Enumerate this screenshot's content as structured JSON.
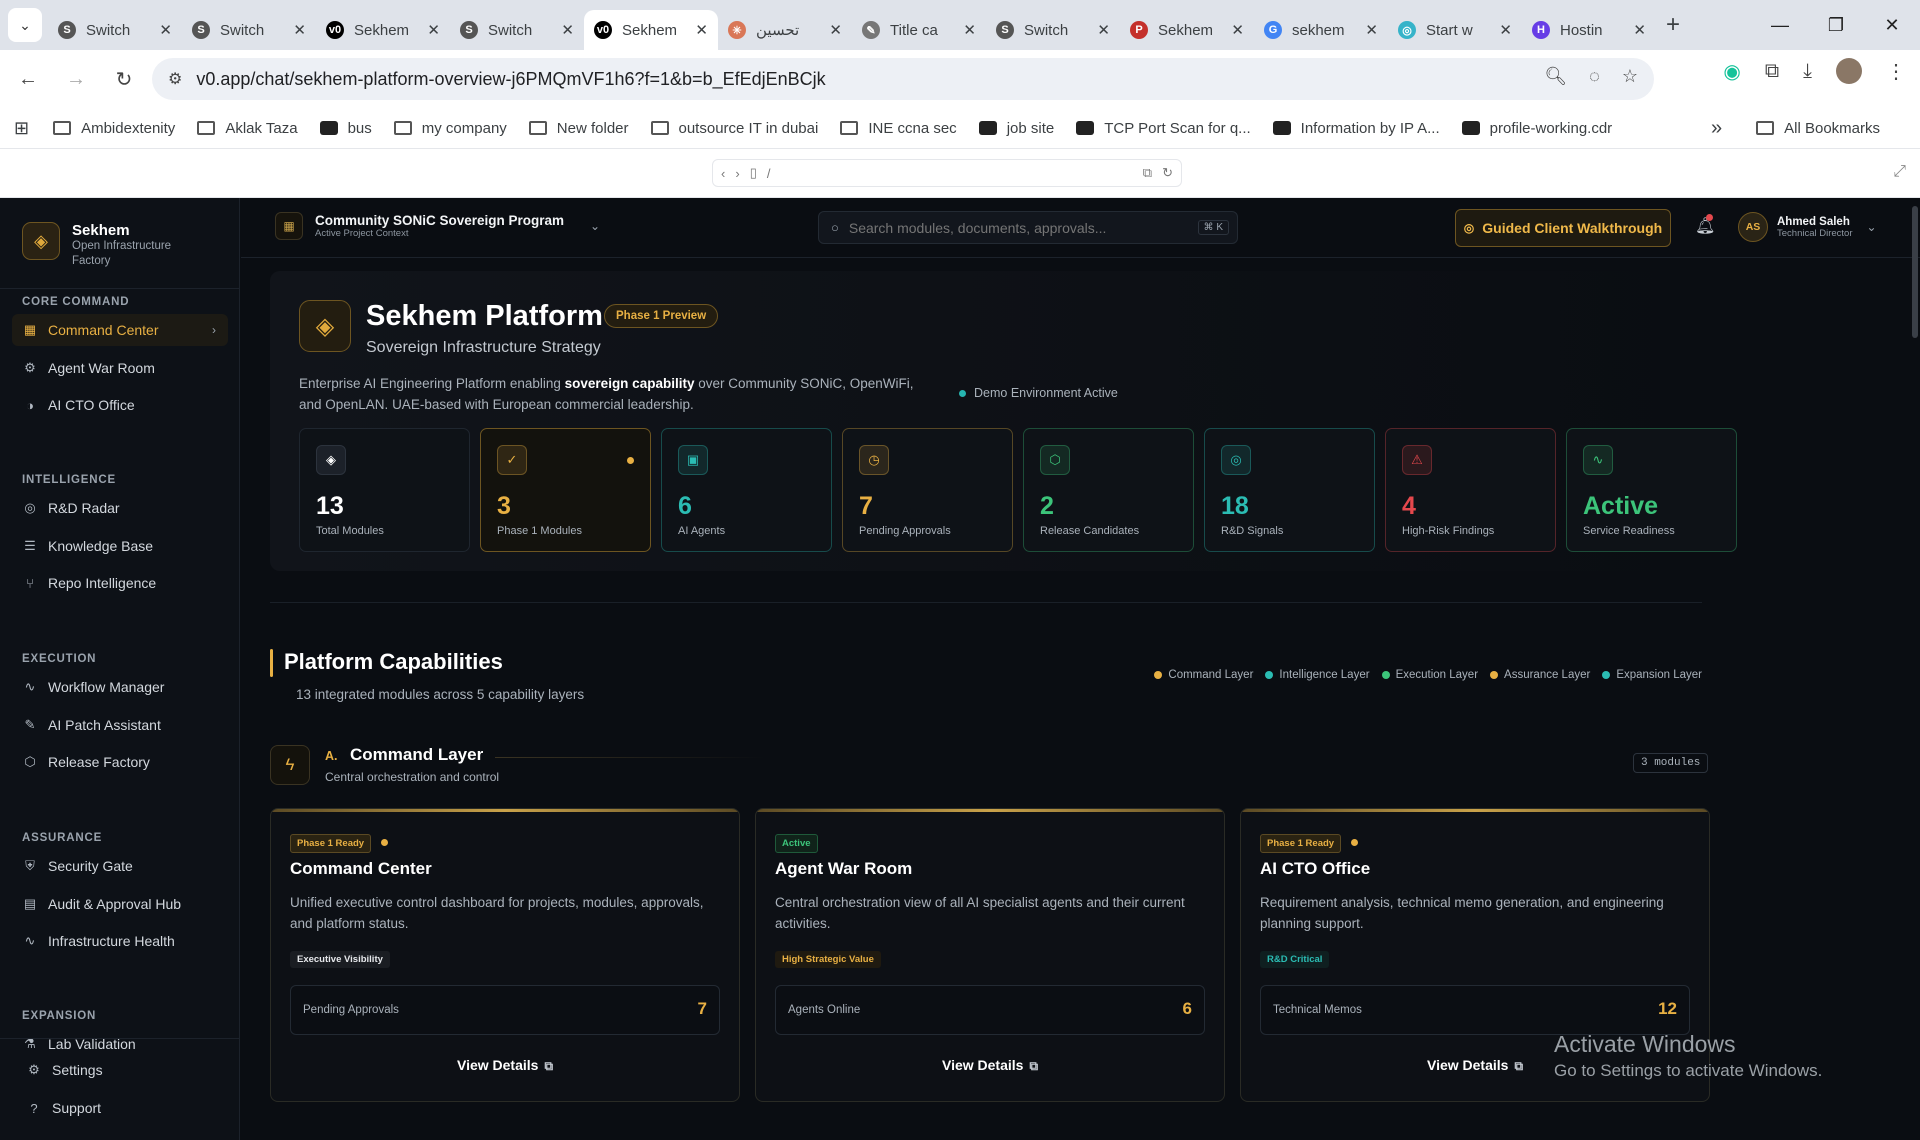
{
  "browser": {
    "tabs": [
      {
        "title": "Switch",
        "favicon": "S",
        "color": "#555"
      },
      {
        "title": "Switch",
        "favicon": "S",
        "color": "#555"
      },
      {
        "title": "Sekhem",
        "favicon": "v0",
        "color": "#000"
      },
      {
        "title": "Switch",
        "favicon": "S",
        "color": "#555"
      },
      {
        "title": "Sekhem",
        "favicon": "v0",
        "color": "#000",
        "active": true
      },
      {
        "title": "تحسين",
        "favicon": "✳",
        "color": "#d97757"
      },
      {
        "title": "Title ca",
        "favicon": "✎",
        "color": "#777"
      },
      {
        "title": "Switch",
        "favicon": "S",
        "color": "#555"
      },
      {
        "title": "Sekhem",
        "favicon": "P",
        "color": "#c4302b"
      },
      {
        "title": "sekhem",
        "favicon": "G",
        "color": "#4285f4"
      },
      {
        "title": "Start w",
        "favicon": "◎",
        "color": "#36b3c9"
      },
      {
        "title": "Hostin",
        "favicon": "H",
        "color": "#673de6"
      }
    ],
    "url": "v0.app/chat/sekhem-platform-overview-j6PMQmVF1h6?f=1&b=b_EfEdjEnBCjk",
    "bookmarks": [
      "Ambidextenity",
      "Aklak Taza",
      "bus",
      "my company",
      "New folder",
      "outsource IT in dubai",
      "INE ccna sec",
      "job site",
      "TCP Port Scan for q...",
      "Information by IP A...",
      "profile-working.cdr"
    ],
    "all_bookmarks": "All Bookmarks",
    "devtools_path": "/"
  },
  "sidebar": {
    "brand_name": "Sekhem",
    "brand_sub": "Open Infrastructure Factory",
    "sections": [
      {
        "title": "CORE COMMAND",
        "items": [
          "Command Center",
          "Agent War Room",
          "AI CTO Office"
        ]
      },
      {
        "title": "INTELLIGENCE",
        "items": [
          "R&D Radar",
          "Knowledge Base",
          "Repo Intelligence"
        ]
      },
      {
        "title": "EXECUTION",
        "items": [
          "Workflow Manager",
          "AI Patch Assistant",
          "Release Factory"
        ]
      },
      {
        "title": "ASSURANCE",
        "items": [
          "Security Gate",
          "Audit & Approval Hub",
          "Infrastructure Health"
        ]
      },
      {
        "title": "EXPANSION",
        "items": [
          "Lab Validation"
        ]
      }
    ],
    "footer": [
      "Settings",
      "Support"
    ]
  },
  "topbar": {
    "project_name": "Community SONiC Sovereign Program",
    "project_sub": "Active Project Context",
    "search_placeholder": "Search modules, documents, approvals...",
    "search_kbd": "⌘ K",
    "walkthrough_label": "Guided Client Walkthrough",
    "user_initials": "AS",
    "user_name": "Ahmed Saleh",
    "user_role": "Technical Director"
  },
  "hero": {
    "title": "Sekhem Platform",
    "badge": "Phase 1 Preview",
    "subtitle": "Sovereign Infrastructure Strategy",
    "desc_pre": "Enterprise AI Engineering Platform enabling ",
    "desc_bold": "sovereign capability",
    "desc_post": " over Community SONiC, OpenWiFi, and OpenLAN. UAE-based with European commercial leadership.",
    "demo_status": "Demo Environment Active"
  },
  "stats": [
    {
      "value": "13",
      "label": "Total Modules",
      "color": "#ffffff",
      "icon": "layers-icon"
    },
    {
      "value": "3",
      "label": "Phase 1 Modules",
      "color": "#e8b043",
      "icon": "check-circle-icon"
    },
    {
      "value": "6",
      "label": "AI Agents",
      "color": "#2bbcb3",
      "icon": "cpu-icon"
    },
    {
      "value": "7",
      "label": "Pending Approvals",
      "color": "#e8b043",
      "icon": "clock-icon"
    },
    {
      "value": "2",
      "label": "Release Candidates",
      "color": "#3cc47a",
      "icon": "package-icon"
    },
    {
      "value": "18",
      "label": "R&D Signals",
      "color": "#2bbcb3",
      "icon": "radar-icon"
    },
    {
      "value": "4",
      "label": "High-Risk Findings",
      "color": "#e5484d",
      "icon": "alert-triangle-icon"
    },
    {
      "value": "Active",
      "label": "Service Readiness",
      "color": "#3cc47a",
      "icon": "activity-icon"
    }
  ],
  "capabilities": {
    "title": "Platform Capabilities",
    "subtitle": "13 integrated modules across 5 capability layers",
    "legend": [
      {
        "label": "Command Layer",
        "color": "#e8b043"
      },
      {
        "label": "Intelligence Layer",
        "color": "#2bbcb3"
      },
      {
        "label": "Execution Layer",
        "color": "#3cc47a"
      },
      {
        "label": "Assurance Layer",
        "color": "#e8b043"
      },
      {
        "label": "Expansion Layer",
        "color": "#2bbcb3"
      }
    ],
    "layer": {
      "letter": "A.",
      "title": "Command Layer",
      "subtitle": "Central orchestration and control",
      "module_count": "3 modules"
    },
    "cards": [
      {
        "status": "Phase 1 Ready",
        "title": "Command Center",
        "desc": "Unified executive control dashboard for projects, modules, approvals, and platform status.",
        "tag": "Executive Visibility",
        "metric_label": "Pending Approvals",
        "metric_value": "7",
        "cta": "View Details"
      },
      {
        "status": "Active",
        "title": "Agent War Room",
        "desc": "Central orchestration view of all AI specialist agents and their current activities.",
        "tag": "High Strategic Value",
        "metric_label": "Agents Online",
        "metric_value": "6",
        "cta": "View Details"
      },
      {
        "status": "Phase 1 Ready",
        "title": "AI CTO Office",
        "desc": "Requirement analysis, technical memo generation, and engineering planning support.",
        "tag": "R&D Critical",
        "metric_label": "Technical Memos",
        "metric_value": "12",
        "cta": "View Details"
      }
    ]
  },
  "watermark": {
    "line1": "Activate Windows",
    "line2": "Go to Settings to activate Windows."
  }
}
